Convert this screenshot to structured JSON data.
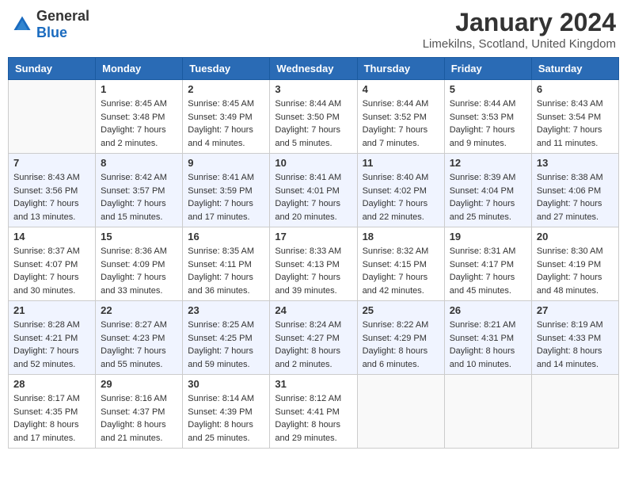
{
  "header": {
    "logo_general": "General",
    "logo_blue": "Blue",
    "month_title": "January 2024",
    "location": "Limekilns, Scotland, United Kingdom"
  },
  "weekdays": [
    "Sunday",
    "Monday",
    "Tuesday",
    "Wednesday",
    "Thursday",
    "Friday",
    "Saturday"
  ],
  "weeks": [
    [
      {
        "day": "",
        "sunrise": "",
        "sunset": "",
        "daylight": ""
      },
      {
        "day": "1",
        "sunrise": "Sunrise: 8:45 AM",
        "sunset": "Sunset: 3:48 PM",
        "daylight": "Daylight: 7 hours and 2 minutes."
      },
      {
        "day": "2",
        "sunrise": "Sunrise: 8:45 AM",
        "sunset": "Sunset: 3:49 PM",
        "daylight": "Daylight: 7 hours and 4 minutes."
      },
      {
        "day": "3",
        "sunrise": "Sunrise: 8:44 AM",
        "sunset": "Sunset: 3:50 PM",
        "daylight": "Daylight: 7 hours and 5 minutes."
      },
      {
        "day": "4",
        "sunrise": "Sunrise: 8:44 AM",
        "sunset": "Sunset: 3:52 PM",
        "daylight": "Daylight: 7 hours and 7 minutes."
      },
      {
        "day": "5",
        "sunrise": "Sunrise: 8:44 AM",
        "sunset": "Sunset: 3:53 PM",
        "daylight": "Daylight: 7 hours and 9 minutes."
      },
      {
        "day": "6",
        "sunrise": "Sunrise: 8:43 AM",
        "sunset": "Sunset: 3:54 PM",
        "daylight": "Daylight: 7 hours and 11 minutes."
      }
    ],
    [
      {
        "day": "7",
        "sunrise": "Sunrise: 8:43 AM",
        "sunset": "Sunset: 3:56 PM",
        "daylight": "Daylight: 7 hours and 13 minutes."
      },
      {
        "day": "8",
        "sunrise": "Sunrise: 8:42 AM",
        "sunset": "Sunset: 3:57 PM",
        "daylight": "Daylight: 7 hours and 15 minutes."
      },
      {
        "day": "9",
        "sunrise": "Sunrise: 8:41 AM",
        "sunset": "Sunset: 3:59 PM",
        "daylight": "Daylight: 7 hours and 17 minutes."
      },
      {
        "day": "10",
        "sunrise": "Sunrise: 8:41 AM",
        "sunset": "Sunset: 4:01 PM",
        "daylight": "Daylight: 7 hours and 20 minutes."
      },
      {
        "day": "11",
        "sunrise": "Sunrise: 8:40 AM",
        "sunset": "Sunset: 4:02 PM",
        "daylight": "Daylight: 7 hours and 22 minutes."
      },
      {
        "day": "12",
        "sunrise": "Sunrise: 8:39 AM",
        "sunset": "Sunset: 4:04 PM",
        "daylight": "Daylight: 7 hours and 25 minutes."
      },
      {
        "day": "13",
        "sunrise": "Sunrise: 8:38 AM",
        "sunset": "Sunset: 4:06 PM",
        "daylight": "Daylight: 7 hours and 27 minutes."
      }
    ],
    [
      {
        "day": "14",
        "sunrise": "Sunrise: 8:37 AM",
        "sunset": "Sunset: 4:07 PM",
        "daylight": "Daylight: 7 hours and 30 minutes."
      },
      {
        "day": "15",
        "sunrise": "Sunrise: 8:36 AM",
        "sunset": "Sunset: 4:09 PM",
        "daylight": "Daylight: 7 hours and 33 minutes."
      },
      {
        "day": "16",
        "sunrise": "Sunrise: 8:35 AM",
        "sunset": "Sunset: 4:11 PM",
        "daylight": "Daylight: 7 hours and 36 minutes."
      },
      {
        "day": "17",
        "sunrise": "Sunrise: 8:33 AM",
        "sunset": "Sunset: 4:13 PM",
        "daylight": "Daylight: 7 hours and 39 minutes."
      },
      {
        "day": "18",
        "sunrise": "Sunrise: 8:32 AM",
        "sunset": "Sunset: 4:15 PM",
        "daylight": "Daylight: 7 hours and 42 minutes."
      },
      {
        "day": "19",
        "sunrise": "Sunrise: 8:31 AM",
        "sunset": "Sunset: 4:17 PM",
        "daylight": "Daylight: 7 hours and 45 minutes."
      },
      {
        "day": "20",
        "sunrise": "Sunrise: 8:30 AM",
        "sunset": "Sunset: 4:19 PM",
        "daylight": "Daylight: 7 hours and 48 minutes."
      }
    ],
    [
      {
        "day": "21",
        "sunrise": "Sunrise: 8:28 AM",
        "sunset": "Sunset: 4:21 PM",
        "daylight": "Daylight: 7 hours and 52 minutes."
      },
      {
        "day": "22",
        "sunrise": "Sunrise: 8:27 AM",
        "sunset": "Sunset: 4:23 PM",
        "daylight": "Daylight: 7 hours and 55 minutes."
      },
      {
        "day": "23",
        "sunrise": "Sunrise: 8:25 AM",
        "sunset": "Sunset: 4:25 PM",
        "daylight": "Daylight: 7 hours and 59 minutes."
      },
      {
        "day": "24",
        "sunrise": "Sunrise: 8:24 AM",
        "sunset": "Sunset: 4:27 PM",
        "daylight": "Daylight: 8 hours and 2 minutes."
      },
      {
        "day": "25",
        "sunrise": "Sunrise: 8:22 AM",
        "sunset": "Sunset: 4:29 PM",
        "daylight": "Daylight: 8 hours and 6 minutes."
      },
      {
        "day": "26",
        "sunrise": "Sunrise: 8:21 AM",
        "sunset": "Sunset: 4:31 PM",
        "daylight": "Daylight: 8 hours and 10 minutes."
      },
      {
        "day": "27",
        "sunrise": "Sunrise: 8:19 AM",
        "sunset": "Sunset: 4:33 PM",
        "daylight": "Daylight: 8 hours and 14 minutes."
      }
    ],
    [
      {
        "day": "28",
        "sunrise": "Sunrise: 8:17 AM",
        "sunset": "Sunset: 4:35 PM",
        "daylight": "Daylight: 8 hours and 17 minutes."
      },
      {
        "day": "29",
        "sunrise": "Sunrise: 8:16 AM",
        "sunset": "Sunset: 4:37 PM",
        "daylight": "Daylight: 8 hours and 21 minutes."
      },
      {
        "day": "30",
        "sunrise": "Sunrise: 8:14 AM",
        "sunset": "Sunset: 4:39 PM",
        "daylight": "Daylight: 8 hours and 25 minutes."
      },
      {
        "day": "31",
        "sunrise": "Sunrise: 8:12 AM",
        "sunset": "Sunset: 4:41 PM",
        "daylight": "Daylight: 8 hours and 29 minutes."
      },
      {
        "day": "",
        "sunrise": "",
        "sunset": "",
        "daylight": ""
      },
      {
        "day": "",
        "sunrise": "",
        "sunset": "",
        "daylight": ""
      },
      {
        "day": "",
        "sunrise": "",
        "sunset": "",
        "daylight": ""
      }
    ]
  ]
}
